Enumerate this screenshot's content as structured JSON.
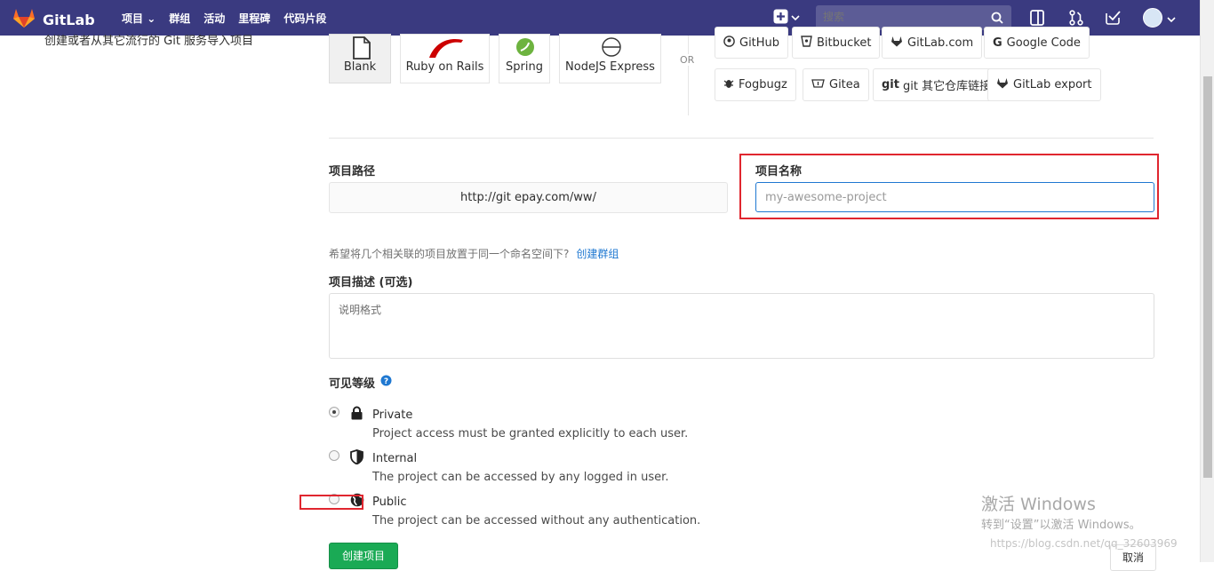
{
  "nav": {
    "brand": "GitLab",
    "menu": [
      "项目",
      "群组",
      "活动",
      "里程碑",
      "代码片段"
    ],
    "search_placeholder": "搜索"
  },
  "left_text": "创建或者从其它流行的 Git 服务导入项目",
  "templates": [
    {
      "label": "Blank",
      "icon": "blank-file-icon"
    },
    {
      "label": "Ruby on Rails",
      "icon": "rails-icon"
    },
    {
      "label": "Spring",
      "icon": "spring-icon"
    },
    {
      "label": "NodeJS Express",
      "icon": "nodejs-icon"
    }
  ],
  "or_text": "OR",
  "imports": [
    {
      "label": "GitHub",
      "icon": "github-icon"
    },
    {
      "label": "Bitbucket",
      "icon": "bitbucket-icon"
    },
    {
      "label": "GitLab.com",
      "icon": "gitlab-icon"
    },
    {
      "label": "Google Code",
      "icon": "google-icon"
    },
    {
      "label": "Fogbugz",
      "icon": "bug-icon"
    },
    {
      "label": "Gitea",
      "icon": "gitea-icon"
    },
    {
      "label": "git 其它仓库链接",
      "icon": "git-icon"
    },
    {
      "label": "GitLab export",
      "icon": "gitlab-icon"
    }
  ],
  "path": {
    "label": "项目路径",
    "value": "http://git      epay.com/ww/"
  },
  "name": {
    "label": "项目名称",
    "placeholder": "my-awesome-project"
  },
  "hint": {
    "text": "希望将几个相关联的项目放置于同一个命名空间下?",
    "link": "创建群组"
  },
  "description": {
    "label": "项目描述 (可选)",
    "placeholder": "说明格式"
  },
  "visibility": {
    "label": "可见等级",
    "options": [
      {
        "title": "Private",
        "desc": "Project access must be granted explicitly to each user.",
        "checked": true,
        "icon": "lock-icon"
      },
      {
        "title": "Internal",
        "desc": "The project can be accessed by any logged in user.",
        "checked": false,
        "icon": "shield-icon"
      },
      {
        "title": "Public",
        "desc": "The project can be accessed without any authentication.",
        "checked": false,
        "icon": "globe-icon"
      }
    ]
  },
  "buttons": {
    "create": "创建项目",
    "cancel": "取消"
  },
  "watermark": {
    "line1": "激活 Windows",
    "line2": "转到“设置”以激活 Windows。",
    "line3": "https://blog.csdn.net/qq_32603969"
  }
}
